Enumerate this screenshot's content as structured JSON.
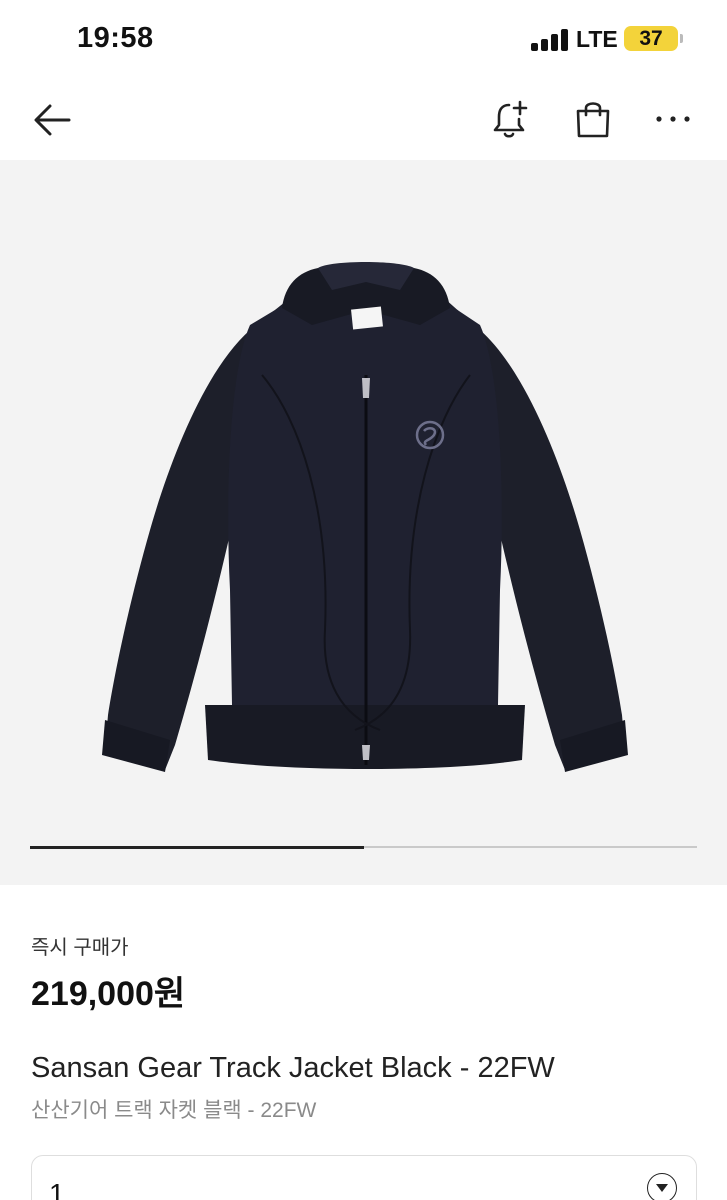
{
  "status_bar": {
    "time": "19:58",
    "network": "LTE",
    "battery": "37"
  },
  "nav": {
    "icons": [
      "back-arrow-icon",
      "bell-plus-icon",
      "shopping-bag-icon",
      "more-icon"
    ]
  },
  "gallery": {
    "progress": 0.5,
    "image": "black track jacket"
  },
  "product": {
    "price_label": "즉시 구매가",
    "price": "219,000원",
    "title_en": "Sansan Gear Track Jacket Black - 22FW",
    "title_ko": "산산기어 트랙 자켓 블랙 - 22FW"
  },
  "size_select": {
    "value": "1"
  },
  "colors": {
    "battery": "#f3d33a",
    "image_bg": "#f3f3f3",
    "jacket": "#1d1f2a"
  }
}
